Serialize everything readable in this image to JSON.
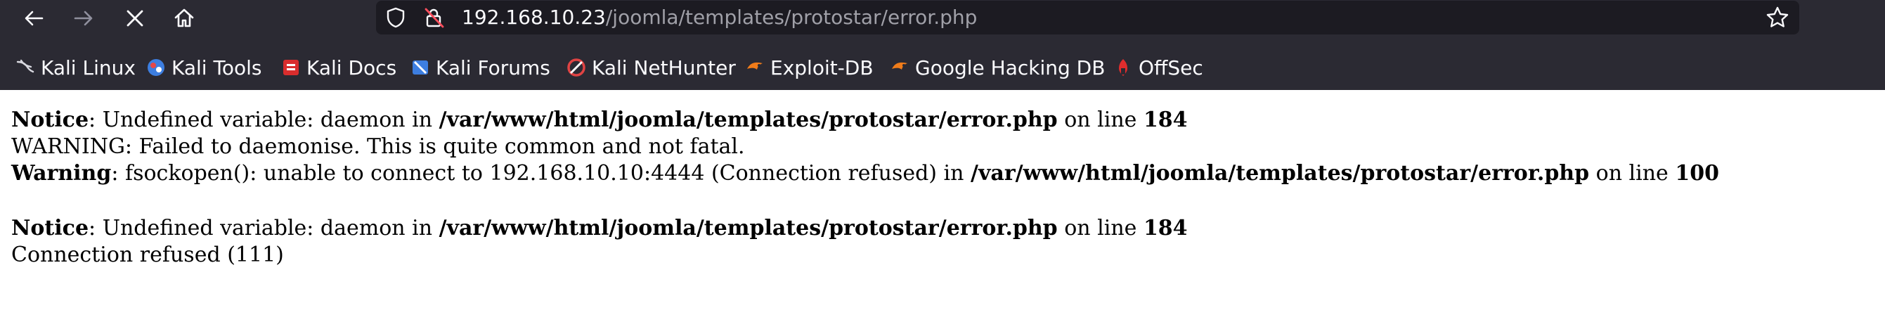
{
  "browser": {
    "url_host": "192.168.10.23",
    "url_path": "/joomla/templates/protostar/error.php",
    "colors": {
      "chrome_bg": "#2b2a33",
      "urlbar_bg": "#1c1b22",
      "text": "#fbfbfe",
      "muted": "#a0a0a8"
    },
    "nav_icons": [
      "back-arrow-icon",
      "forward-arrow-icon",
      "stop-x-icon",
      "home-icon"
    ],
    "url_icons": [
      "shield-icon",
      "insecure-lock-icon"
    ],
    "bookmark_star_icon": "star-icon"
  },
  "bookmarks": [
    {
      "label": "Kali Linux",
      "icon": "kali-dragon-icon"
    },
    {
      "label": "Kali Tools",
      "icon": "kali-tools-icon"
    },
    {
      "label": "Kali Docs",
      "icon": "kali-docs-icon"
    },
    {
      "label": "Kali Forums",
      "icon": "kali-forums-icon"
    },
    {
      "label": "Kali NetHunter",
      "icon": "nethunter-icon"
    },
    {
      "label": "Exploit-DB",
      "icon": "exploit-db-icon"
    },
    {
      "label": "Google Hacking DB",
      "icon": "ghdb-icon"
    },
    {
      "label": "OffSec",
      "icon": "offsec-icon"
    }
  ],
  "page": {
    "msg1": {
      "level": "Notice",
      "text": ": Undefined variable: daemon in ",
      "file": "/var/www/html/joomla/templates/protostar/error.php",
      "on_line": " on line ",
      "line": "184"
    },
    "msg2": "WARNING: Failed to daemonise. This is quite common and not fatal.",
    "msg3": {
      "level": "Warning",
      "text": ": fsockopen(): unable to connect to 192.168.10.10:4444 (Connection refused) in ",
      "file": "/var/www/html/joomla/templates/protostar/error.php",
      "on_line": " on line ",
      "line": "100"
    },
    "msg4": {
      "level": "Notice",
      "text": ": Undefined variable: daemon in ",
      "file": "/var/www/html/joomla/templates/protostar/error.php",
      "on_line": " on line ",
      "line": "184"
    },
    "msg5": "Connection refused (111)"
  }
}
